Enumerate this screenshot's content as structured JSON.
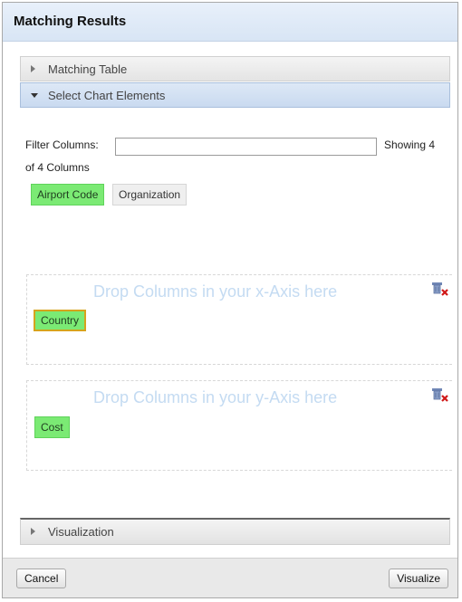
{
  "dialog": {
    "title": "Matching Results"
  },
  "sections": {
    "matching_table": "Matching Table",
    "select_chart_elements": "Select Chart Elements",
    "visualization": "Visualization"
  },
  "filter": {
    "label": "Filter Columns:",
    "value": "",
    "placeholder": "",
    "showing_line1": "Showing 4",
    "showing_line2": "of 4 Columns"
  },
  "available_columns": [
    "Airport Code",
    "Organization"
  ],
  "x_axis": {
    "hint": "Drop Columns in your x-Axis here",
    "columns": [
      "Country"
    ]
  },
  "y_axis": {
    "hint": "Drop Columns in your y-Axis here",
    "columns": [
      "Cost"
    ]
  },
  "footer": {
    "cancel_label": "Cancel",
    "visualize_label": "Visualize"
  },
  "icons": {
    "remove": "remove-column-icon",
    "collapsed": "triangle-right-icon",
    "expanded": "triangle-down-icon"
  },
  "colors": {
    "chip_green": "#7bea74",
    "chip_selected_border": "#d6a31c",
    "drop_hint": "#c4dbf2",
    "active_section": "#c9daf0"
  }
}
